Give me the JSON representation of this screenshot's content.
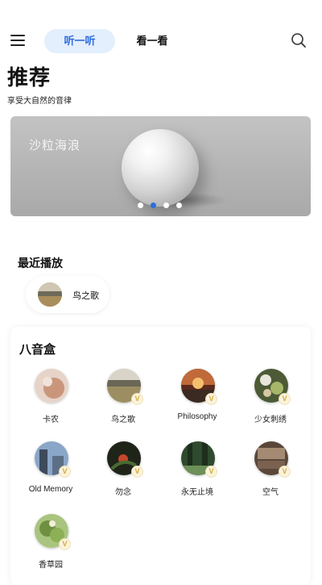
{
  "header": {
    "tabs": [
      {
        "label": "听一听",
        "active": true
      },
      {
        "label": "看一看",
        "active": false
      }
    ],
    "icons": {
      "menu": "hamburger-menu-icon",
      "search": "search-icon"
    }
  },
  "page": {
    "title": "推荐",
    "subtitle": "享受大自然的音律"
  },
  "banner": {
    "text": "沙粒海浪",
    "slide_count": 4,
    "active_slide": 2
  },
  "recent": {
    "title": "最近播放",
    "items": [
      {
        "label": "鸟之歌"
      }
    ]
  },
  "musicbox": {
    "title": "八音盒",
    "badge": "V",
    "items": [
      {
        "label": "卡农",
        "color": "#c9967c"
      },
      {
        "label": "鸟之歌",
        "color": "#9c8e62"
      },
      {
        "label": "Philosophy",
        "color": "#a8452f"
      },
      {
        "label": "少女刺绣",
        "color": "#6d7a4b"
      },
      {
        "label": "Old Memory",
        "color": "#5f7aa1"
      },
      {
        "label": "勿念",
        "color": "#2f3426"
      },
      {
        "label": "永无止境",
        "color": "#3c5a3a"
      },
      {
        "label": "空气",
        "color": "#7b6150"
      },
      {
        "label": "香草园",
        "color": "#7a9c4e"
      }
    ]
  },
  "colors": {
    "accent": "#2d6cdf",
    "tab_active_bg": "#e3effd",
    "vip": "#d4a93a"
  }
}
